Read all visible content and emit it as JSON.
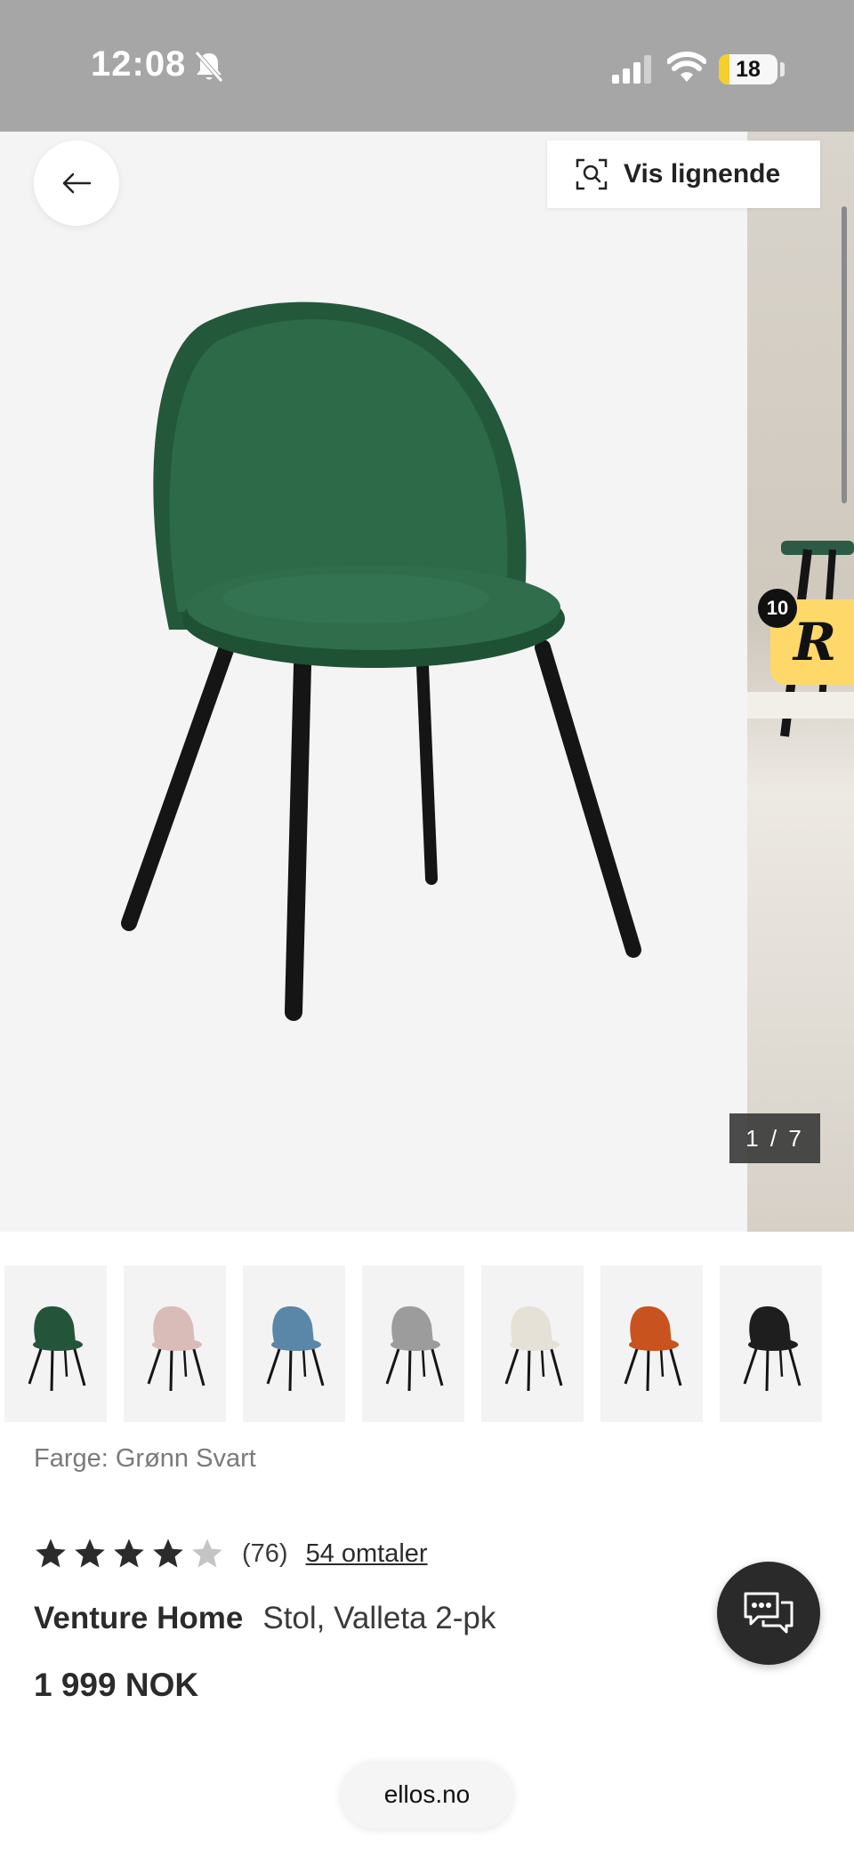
{
  "status_bar": {
    "time": "12:08",
    "battery_level": "18",
    "battery_fraction": 0.18,
    "battery_color": "#f4cf2e",
    "icons": [
      "bell-slash-icon",
      "signal-icon",
      "wifi-icon",
      "battery-icon"
    ]
  },
  "gallery": {
    "similar_button_label": "Vis lignende",
    "pager": "1 / 7",
    "badge_letter": "R",
    "badge_count": "10",
    "icons": [
      "arrow-left-icon",
      "visual-search-icon"
    ]
  },
  "variants": [
    {
      "name": "Grønn Svart",
      "color": "#24553a"
    },
    {
      "name": "pink",
      "color": "#d9bbb8"
    },
    {
      "name": "blue",
      "color": "#5a86a8"
    },
    {
      "name": "grey",
      "color": "#9c9c9c"
    },
    {
      "name": "cream",
      "color": "#e6e1d6"
    },
    {
      "name": "orange",
      "color": "#c8531f"
    },
    {
      "name": "black",
      "color": "#1e1e1e"
    }
  ],
  "product": {
    "color_label": "Farge: Grønn Svart",
    "rating_value": 4,
    "rating_max": 5,
    "rating_count": "(76)",
    "reviews_link": "54 omtaler",
    "brand": "Venture Home",
    "title": "Stol, Valleta 2-pk",
    "price": "1 999 NOK"
  },
  "chat": {
    "icon": "chat-bubbles-icon"
  },
  "browser": {
    "url": "ellos.no"
  }
}
